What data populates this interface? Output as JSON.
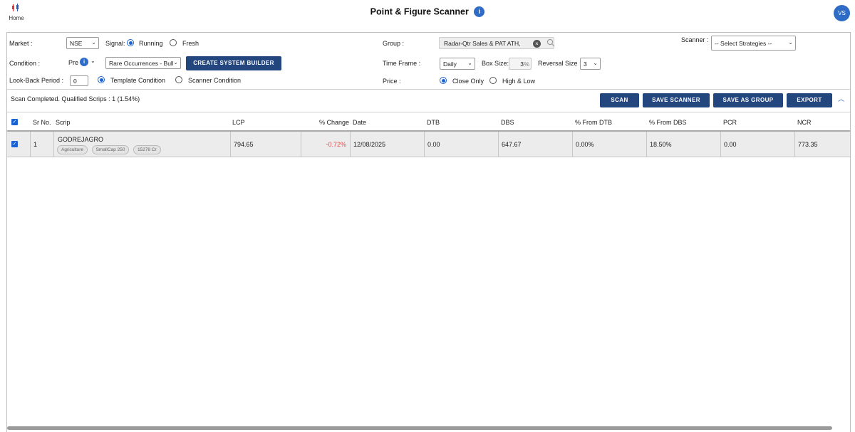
{
  "header": {
    "home_label": "Home",
    "title": "Point & Figure Scanner",
    "info_glyph": "i",
    "avatar_initials": "VS"
  },
  "form": {
    "market_label": "Market :",
    "market_value": "NSE",
    "signal_label": "Signal:",
    "signal_options": [
      "Running",
      "Fresh"
    ],
    "signal_selected": "Running",
    "condition_label": "Condition :",
    "condition_prefix": "Pre",
    "condition_value": "Rare Occurrences - Bulli",
    "create_system_builder": "CREATE SYSTEM BUILDER",
    "lookback_label": "Look-Back Period :",
    "lookback_value": "0",
    "condition_type_options": [
      "Template Condition",
      "Scanner Condition"
    ],
    "condition_type_selected": "Template Condition",
    "group_label": "Group :",
    "group_value": "Radar-Qtr Sales & PAT ATH,",
    "timeframe_label": "Time Frame :",
    "timeframe_value": "Daily",
    "boxsize_label": "Box Size:",
    "boxsize_value": "3",
    "boxsize_unit": "%",
    "reversal_label": "Reversal Size :",
    "reversal_value": "3",
    "price_label": "Price :",
    "price_options": [
      "Close Only",
      "High & Low"
    ],
    "price_selected": "Close Only",
    "scanner_label": "Scanner :",
    "scanner_placeholder": "-- Select Strategies --"
  },
  "results": {
    "status_text": "Scan Completed. Qualified Scrips : 1 (1.54%)",
    "buttons": {
      "scan": "SCAN",
      "save_scanner": "SAVE SCANNER",
      "save_as_group": "SAVE AS GROUP",
      "export": "EXPORT"
    }
  },
  "table": {
    "columns": [
      "Sr No.",
      "Scrip",
      "LCP",
      "% Change",
      "Date",
      "DTB",
      "DBS",
      "% From DTB",
      "% From DBS",
      "PCR",
      "NCR"
    ],
    "rows": [
      {
        "sr": "1",
        "scrip": "GODREJAGRO",
        "tags": [
          "Agriculture",
          "SmallCap 250",
          "15278 Cr"
        ],
        "lcp": "794.65",
        "change": "-0.72%",
        "date": "12/08/2025",
        "dtb": "0.00",
        "dbs": "647.67",
        "from_dtb": "0.00%",
        "from_dbs": "18.50%",
        "pcr": "0.00",
        "ncr": "773.35"
      }
    ]
  },
  "colors": {
    "accent": "#2f6cc7",
    "button": "#23467e",
    "negative": "#e05050",
    "row_bg": "#ececec"
  },
  "icons": {
    "home": "candlestick-icon",
    "info": "info-icon",
    "clear": "clear-icon",
    "search": "search-icon",
    "dropdown": "chevron-down-icon",
    "collapse": "chevron-up-icon",
    "checkbox": "checkbox-checked-icon"
  }
}
